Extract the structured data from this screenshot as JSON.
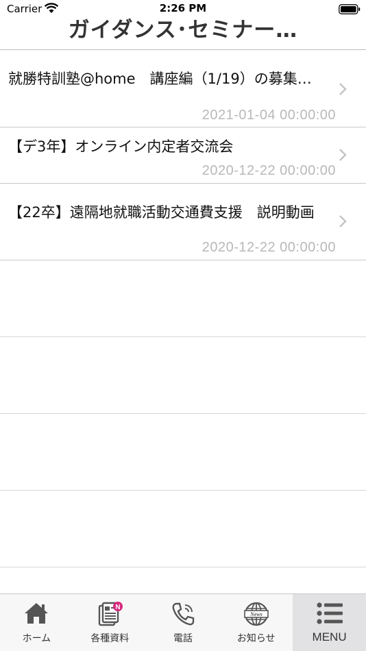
{
  "status_bar": {
    "carrier": "Carrier",
    "time": "2:26 PM"
  },
  "nav": {
    "title": "ガイダンス･セミナー…"
  },
  "items": [
    {
      "title": "就勝特訓塾@home　講座編（1/19）の募集…",
      "date": "2021-01-04 00:00:00"
    },
    {
      "title": "【デ3年】オンライン内定者交流会",
      "date": "2020-12-22 00:00:00"
    },
    {
      "title": "【22卒】遠隔地就職活動交通費支援　説明動画",
      "date": "2020-12-22 00:00:00"
    }
  ],
  "tabbar": {
    "tabs": [
      {
        "label": "ホーム",
        "icon": "home-icon"
      },
      {
        "label": "各種資料",
        "icon": "documents-icon",
        "badge": "N"
      },
      {
        "label": "電話",
        "icon": "phone-icon"
      },
      {
        "label": "お知らせ",
        "icon": "news-globe-icon",
        "icon_text": "News"
      },
      {
        "label": "MENU",
        "icon": "menu-list-icon"
      }
    ],
    "active_index": 4
  },
  "colors": {
    "accent_badge": "#d6287f",
    "text": "#111111",
    "date": "#b8b8b8"
  }
}
